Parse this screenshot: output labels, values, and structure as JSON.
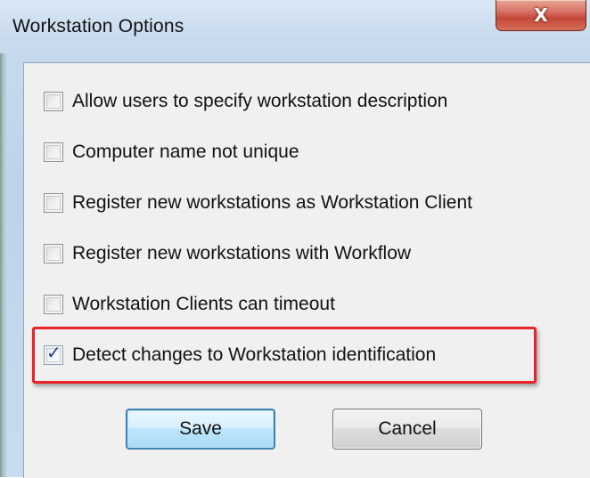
{
  "window": {
    "title": "Workstation Options",
    "close_glyph": "X"
  },
  "options": [
    {
      "label": "Allow users to specify workstation description",
      "checked": false
    },
    {
      "label": "Computer name not unique",
      "checked": false
    },
    {
      "label": "Register new workstations as Workstation Client",
      "checked": false
    },
    {
      "label": "Register new workstations with Workflow",
      "checked": false
    },
    {
      "label": "Workstation Clients can timeout",
      "checked": false
    },
    {
      "label": "Detect changes to Workstation identification",
      "checked": true
    }
  ],
  "check_glyph": "✓",
  "buttons": {
    "save": "Save",
    "cancel": "Cancel"
  },
  "colors": {
    "highlight": "#e8232a",
    "close_button": "#c4483a",
    "client_background": "#f0f0f0"
  }
}
